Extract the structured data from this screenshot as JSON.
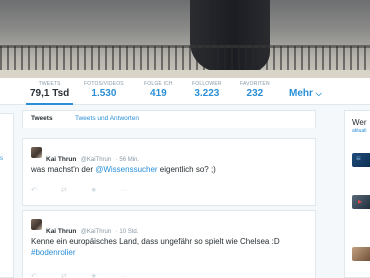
{
  "profile_nav": {
    "stats": [
      {
        "label": "TWEETS",
        "value": "79,1 Tsd"
      },
      {
        "label": "FOTOS/VIDEOS",
        "value": "1.530"
      },
      {
        "label": "FOLGE ICH",
        "value": "419"
      },
      {
        "label": "FOLLOWER",
        "value": "3.223"
      },
      {
        "label": "FAVORITEN",
        "value": "232"
      }
    ],
    "more_label": "Mehr",
    "accent_color": "#2a8fd6"
  },
  "timeline_tabs": {
    "tweets": "Tweets",
    "tweets_and_replies": "Tweets und Antworten"
  },
  "tweets": [
    {
      "name": "Kai Thrun",
      "handle": "@KaiThrun",
      "time": "· 56 Min.",
      "text_before": "was machst'n der ",
      "mention": "@Wissenssucher",
      "text_after": " eigentlich so? ;)"
    },
    {
      "name": "Kai Thrun",
      "handle": "@KaiThrun",
      "time": "· 10 Std.",
      "text": "Kenne ein europäisches Land, dass ungefähr so spielt wie Chelsea :D",
      "hashtag": "#bodenrolier"
    }
  ],
  "sidebar": {
    "title": "Wer",
    "subtitle": "aktuali"
  },
  "left_fragment": "s"
}
